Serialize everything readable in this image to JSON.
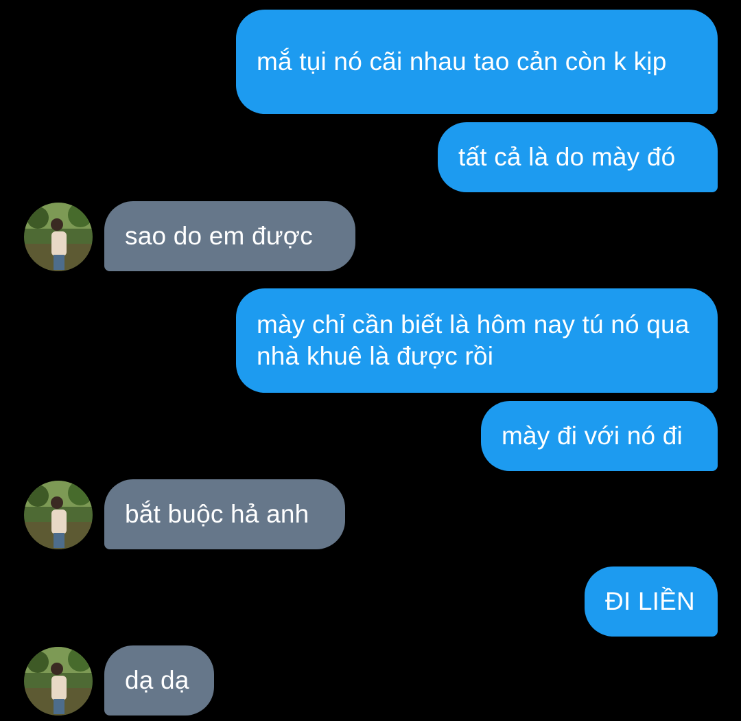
{
  "conversation": {
    "messages": [
      {
        "sender": "me",
        "text": "mắ tụi nó cãi nhau tao cản còn k kịp"
      },
      {
        "sender": "me",
        "text": "tất cả là do mày đó"
      },
      {
        "sender": "contact",
        "text": "sao do em được"
      },
      {
        "sender": "me",
        "text": "mày chỉ cần biết là hôm nay tú nó qua nhà khuê là được rồi"
      },
      {
        "sender": "me",
        "text": "mày đi với nó đi"
      },
      {
        "sender": "contact",
        "text": "bắt buộc hả anh"
      },
      {
        "sender": "me",
        "text": "ĐI LIỀN"
      },
      {
        "sender": "contact",
        "text": "dạ dạ"
      }
    ]
  },
  "colors": {
    "background": "#000000",
    "sent_bubble": "#1d9bf0",
    "received_bubble": "#66778a",
    "text": "#ffffff"
  },
  "icons": {
    "avatar": "contact-avatar-photo"
  }
}
